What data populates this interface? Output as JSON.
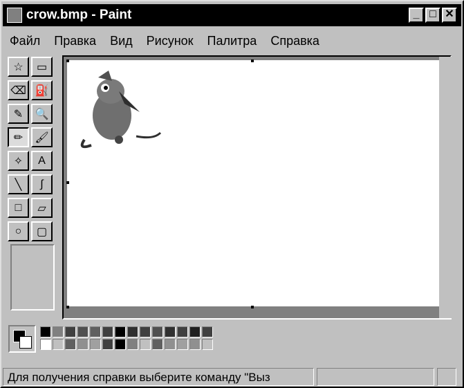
{
  "window": {
    "title": "crow.bmp - Paint"
  },
  "menu": [
    "Файл",
    "Правка",
    "Вид",
    "Рисунок",
    "Палитра",
    "Справка"
  ],
  "tools": [
    {
      "name": "free-form-select-icon",
      "glyph": "☆"
    },
    {
      "name": "rect-select-icon",
      "glyph": "▭"
    },
    {
      "name": "eraser-icon",
      "glyph": "⌫"
    },
    {
      "name": "fill-icon",
      "glyph": "⛽"
    },
    {
      "name": "pick-color-icon",
      "glyph": "✎"
    },
    {
      "name": "magnifier-icon",
      "glyph": "🔍"
    },
    {
      "name": "pencil-icon",
      "glyph": "✏"
    },
    {
      "name": "brush-icon",
      "glyph": "🖌"
    },
    {
      "name": "airbrush-icon",
      "glyph": "✧"
    },
    {
      "name": "text-icon",
      "glyph": "A"
    },
    {
      "name": "line-icon",
      "glyph": "╲"
    },
    {
      "name": "curve-icon",
      "glyph": "∫"
    },
    {
      "name": "rectangle-icon",
      "glyph": "□"
    },
    {
      "name": "polygon-icon",
      "glyph": "▱"
    },
    {
      "name": "ellipse-icon",
      "glyph": "○"
    },
    {
      "name": "rounded-rect-icon",
      "glyph": "▢"
    }
  ],
  "palette_top": [
    "#000000",
    "#808080",
    "#404040",
    "#505050",
    "#606060",
    "#404040",
    "#000000",
    "#303030",
    "#404040",
    "#505050",
    "#303030",
    "#404040",
    "#202020",
    "#404040"
  ],
  "palette_bottom": [
    "#ffffff",
    "#c0c0c0",
    "#606060",
    "#909090",
    "#a0a0a0",
    "#404040",
    "#000000",
    "#808080",
    "#c0c0c0",
    "#606060",
    "#909090",
    "#a0a0a0",
    "#909090",
    "#c0c0c0"
  ],
  "status": "Для получения справки выберите команду \"Выз"
}
